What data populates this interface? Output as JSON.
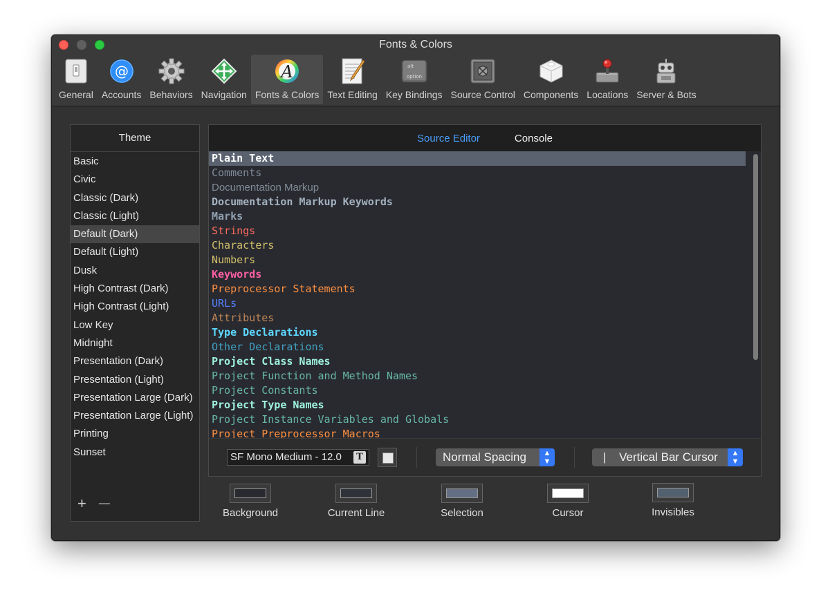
{
  "window": {
    "title": "Fonts & Colors"
  },
  "toolbar": {
    "items": [
      {
        "label": "General",
        "icon": "general-icon"
      },
      {
        "label": "Accounts",
        "icon": "at-sign-icon"
      },
      {
        "label": "Behaviors",
        "icon": "gear-icon"
      },
      {
        "label": "Navigation",
        "icon": "navigation-arrows-icon"
      },
      {
        "label": "Fonts & Colors",
        "icon": "fonts-colors-icon",
        "selected": true
      },
      {
        "label": "Text Editing",
        "icon": "text-editing-icon"
      },
      {
        "label": "Key Bindings",
        "icon": "option-key-icon",
        "key_top": "alt",
        "key_bottom": "option"
      },
      {
        "label": "Source Control",
        "icon": "vault-icon"
      },
      {
        "label": "Components",
        "icon": "cube-icon"
      },
      {
        "label": "Locations",
        "icon": "joystick-drive-icon"
      },
      {
        "label": "Server & Bots",
        "icon": "robot-icon"
      }
    ]
  },
  "sidebar": {
    "header": "Theme",
    "items": [
      "Basic",
      "Civic",
      "Classic (Dark)",
      "Classic (Light)",
      "Default (Dark)",
      "Default (Light)",
      "Dusk",
      "High Contrast (Dark)",
      "High Contrast (Light)",
      "Low Key",
      "Midnight",
      "Presentation (Dark)",
      "Presentation (Light)",
      "Presentation Large (Dark)",
      "Presentation Large (Light)",
      "Printing",
      "Sunset"
    ],
    "selected_index": 4,
    "add_label": "+",
    "remove_label": "—"
  },
  "tabs": {
    "source_editor": "Source Editor",
    "console": "Console"
  },
  "syntax_items": [
    {
      "label": "Plain Text",
      "color": "#ffffff",
      "bold": true,
      "selected": true
    },
    {
      "label": "Comments",
      "color": "#7f8c98",
      "bold": false
    },
    {
      "label": "Documentation Markup",
      "color": "#7f8c98",
      "bold": false,
      "sans": true
    },
    {
      "label": "Documentation Markup Keywords",
      "color": "#a3b1bf",
      "bold": true
    },
    {
      "label": "Marks",
      "color": "#92a1b1",
      "bold": true
    },
    {
      "label": "Strings",
      "color": "#fc6a5d",
      "bold": false
    },
    {
      "label": "Characters",
      "color": "#d0bf69",
      "bold": false
    },
    {
      "label": "Numbers",
      "color": "#d0bf69",
      "bold": false
    },
    {
      "label": "Keywords",
      "color": "#fc5fa3",
      "bold": true
    },
    {
      "label": "Preprocessor Statements",
      "color": "#fd8f3f",
      "bold": false
    },
    {
      "label": "URLs",
      "color": "#5482ff",
      "bold": false
    },
    {
      "label": "Attributes",
      "color": "#bf8555",
      "bold": false
    },
    {
      "label": "Type Declarations",
      "color": "#5dd8ff",
      "bold": true
    },
    {
      "label": "Other Declarations",
      "color": "#41a1c0",
      "bold": false
    },
    {
      "label": "Project Class Names",
      "color": "#9ef1dd",
      "bold": true
    },
    {
      "label": "Project Function and Method Names",
      "color": "#67b7a4",
      "bold": false
    },
    {
      "label": "Project Constants",
      "color": "#67b7a4",
      "bold": false
    },
    {
      "label": "Project Type Names",
      "color": "#9ef1dd",
      "bold": true
    },
    {
      "label": "Project Instance Variables and Globals",
      "color": "#67b7a4",
      "bold": false
    },
    {
      "label": "Project Preprocessor Macros",
      "color": "#fd8f3f",
      "bold": false
    }
  ],
  "controls": {
    "font": "SF Mono Medium - 12.0",
    "font_button_glyph": "T",
    "spacing": "Normal Spacing",
    "cursor": "Vertical Bar Cursor",
    "cursor_glyph": "|"
  },
  "swatches": [
    {
      "label": "Background",
      "color": "#292a30"
    },
    {
      "label": "Current Line",
      "color": "#2f3239"
    },
    {
      "label": "Selection",
      "color": "#646f83"
    },
    {
      "label": "Cursor",
      "color": "#ffffff"
    },
    {
      "label": "Invisibles",
      "color": "#53606e"
    }
  ]
}
